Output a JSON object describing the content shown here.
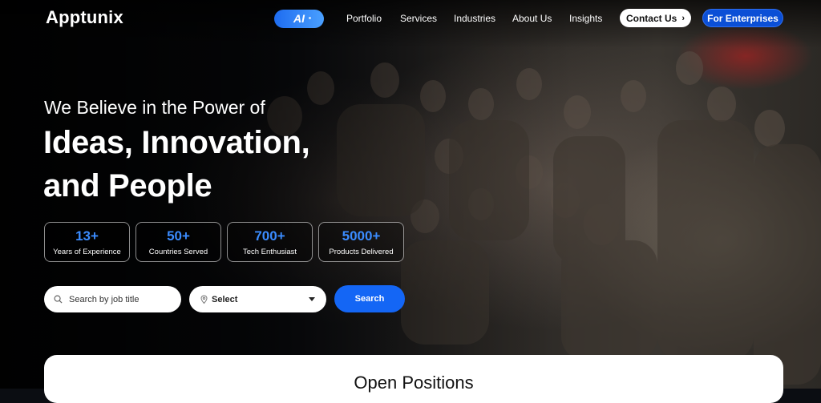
{
  "brand": {
    "name": "Apptunix"
  },
  "nav": {
    "ai_label": "AI",
    "links": [
      "Portfolio",
      "Services",
      "Industries",
      "About Us",
      "Insights"
    ],
    "contact_label": "Contact Us",
    "enterprise_label": "For Enterprises"
  },
  "hero": {
    "subtitle": "We Believe in the Power of",
    "title_line1": "Ideas, Innovation,",
    "title_line2": "and People"
  },
  "stats": [
    {
      "value": "13+",
      "label": "Years of Experience"
    },
    {
      "value": "50+",
      "label": "Countries Served"
    },
    {
      "value": "700+",
      "label": "Tech Enthusiast"
    },
    {
      "value": "5000+",
      "label": "Products Delivered"
    }
  ],
  "search": {
    "placeholder": "Search by job title",
    "select_value": "Select",
    "button_label": "Search"
  },
  "section": {
    "title": "Open Positions"
  },
  "colors": {
    "accent": "#1466f5",
    "stat_number": "#3b8cff",
    "enterprise_bg": "#0b4fd6"
  }
}
